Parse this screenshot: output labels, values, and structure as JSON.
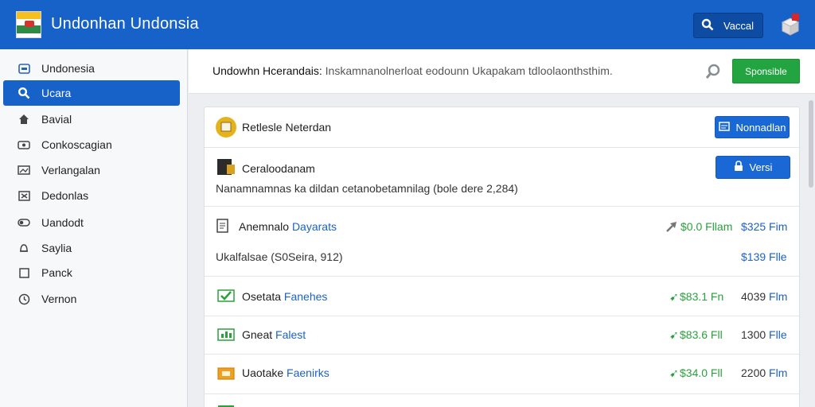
{
  "app": {
    "title": "Undonhan Undonsia",
    "search_label": "Vaccal"
  },
  "sidebar": {
    "items": [
      {
        "label": "Undonesia",
        "icon": "folder-icon"
      },
      {
        "label": "Ucara",
        "icon": "search-icon",
        "active": true
      },
      {
        "label": "Bavial",
        "icon": "home-icon"
      },
      {
        "label": "Conkoscagian",
        "icon": "camera-icon"
      },
      {
        "label": "Verlangalan",
        "icon": "image-icon"
      },
      {
        "label": "Dedonlas",
        "icon": "close-box-icon"
      },
      {
        "label": "Uandodt",
        "icon": "switch-icon"
      },
      {
        "label": "Saylia",
        "icon": "bell-icon"
      },
      {
        "label": "Panck",
        "icon": "box-icon"
      },
      {
        "label": "Vernon",
        "icon": "clock-icon"
      }
    ]
  },
  "header": {
    "title": "Undowhn Hcerandais:",
    "subtitle": "Inskamnanolnerloat eodounn Ukapakam tdloolaonthsthim.",
    "submit_label": "Sponsible"
  },
  "card": {
    "row1": {
      "title": "Retlesle Neterdan",
      "button": "Nonnadlan"
    },
    "row2": {
      "title": "Ceraloodanam",
      "button": "Versi",
      "desc": "Nanamnamnas ka dildan cetanobetamnilag (bole dere 2,284)"
    },
    "row3": {
      "title_black": "Anemnalo",
      "title_blue": "Dayarats",
      "trend": "$0.0 Fllam",
      "amount": "$325 Fim",
      "sub": "Ukalfalsae (S0Seira, 912)",
      "sub_amount": "$139 Flle"
    },
    "row4": {
      "title_black": "Osetata",
      "title_blue": "Fanehes",
      "trend": "$83.1 Fn",
      "amount_black": "4039",
      "amount_blue": "Flm"
    },
    "row5": {
      "title_black": "Gneat",
      "title_blue": "Falest",
      "trend": "$83.6 Fll",
      "amount_black": "1300",
      "amount_blue": "Flle"
    },
    "row6": {
      "title_black": "Uaotake",
      "title_blue": "Faenirks",
      "trend": "$34.0 Fll",
      "amount_black": "2200",
      "amount_blue": "Flm"
    }
  },
  "colors": {
    "primary": "#1762c9",
    "success": "#22a440",
    "link": "#1d62c5"
  }
}
